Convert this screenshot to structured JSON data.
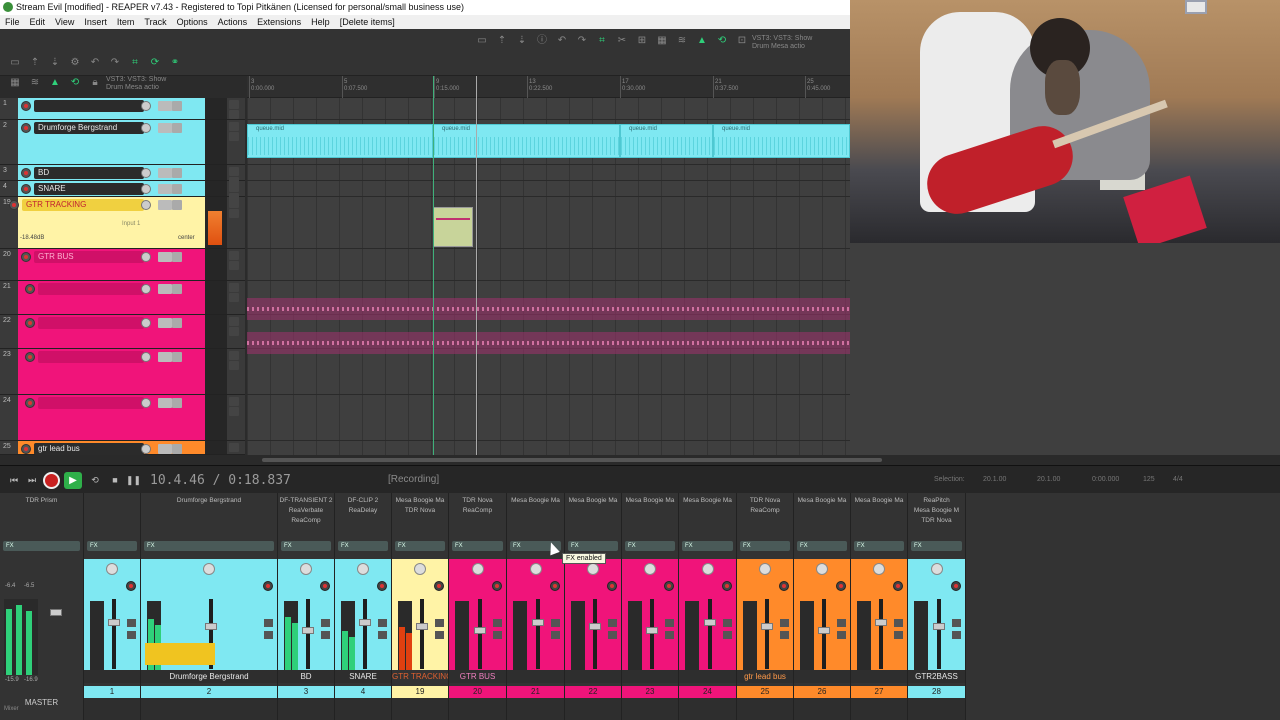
{
  "window": {
    "title": "Stream Evil [modified] - REAPER v7.43 - Registered to Topi Pitkänen (Licensed for personal/small business use)"
  },
  "menu": [
    "File",
    "Edit",
    "View",
    "Insert",
    "Item",
    "Track",
    "Options",
    "Actions",
    "Extensions",
    "Help",
    "[Delete items]"
  ],
  "toolbar": {
    "vst_top": "VST3: VST3: Show",
    "vst_bottom": "Drum Mesa actio"
  },
  "tcp": {
    "tracks": [
      {
        "name": "",
        "num": "1",
        "color": "#7fe8f2"
      },
      {
        "name": "Drumforge Bergstrand",
        "num": "2",
        "color": "#7fe8f2"
      },
      {
        "name": "BD",
        "num": "3",
        "color": "#7fe8f2"
      },
      {
        "name": "SNARE",
        "num": "4",
        "color": "#7fe8f2"
      },
      {
        "name": "GTR TRACKING",
        "num": "19",
        "color": "#fff3a6",
        "vol": "-18.48dB",
        "input": "Input 1",
        "pan": "center"
      },
      {
        "name": "GTR BUS",
        "num": "20",
        "color": "#f0147a"
      },
      {
        "name": "",
        "num": "21",
        "color": "#f0147a"
      },
      {
        "name": "",
        "num": "22",
        "color": "#f0147a"
      },
      {
        "name": "",
        "num": "23",
        "color": "#f0147a"
      },
      {
        "name": "",
        "num": "24",
        "color": "#f0147a"
      },
      {
        "name": "gtr lead bus",
        "num": "25",
        "color": "#ff8a2a"
      }
    ]
  },
  "ruler": {
    "marks": [
      {
        "bar": "3",
        "time": "0:00.000"
      },
      {
        "bar": "5",
        "time": "0:07.500"
      },
      {
        "bar": "9",
        "time": "0:15.000"
      },
      {
        "bar": "13",
        "time": "0:22.500"
      },
      {
        "bar": "17",
        "time": "0:30.000"
      },
      {
        "bar": "21",
        "time": "0:37.500"
      },
      {
        "bar": "25",
        "time": "0:45.000"
      }
    ]
  },
  "arrange": {
    "midi_items": [
      "queue.mid",
      "queue.mid",
      "queue.mid",
      "queue.mid"
    ]
  },
  "transport": {
    "position": "10.4.46 / 0:18.837",
    "status": "[Recording]",
    "selection_label": "Selection:",
    "sel_start": "20.1.00",
    "sel_end": "20.1.00",
    "sel_len": "0:00.000",
    "bpm": "125",
    "timesig": "4/4"
  },
  "mixer": {
    "master": {
      "name": "MASTER",
      "fx": "TDR Prism",
      "vol": "-15.9",
      "vol2": "-16.9",
      "peak": "-6.4",
      "peak2": "-6.5"
    },
    "strips": [
      {
        "name": "",
        "num": "1",
        "color": "#7fe8f2",
        "fx": ""
      },
      {
        "name": "Drumforge Bergstrand",
        "num": "2",
        "color": "#7fe8f2",
        "fx": "Drumforge Bergstrand"
      },
      {
        "name": "BD",
        "num": "3",
        "color": "#7fe8f2",
        "fx": "DF-TRANSIENT 2\nReaVerbate\nReaComp"
      },
      {
        "name": "SNARE",
        "num": "4",
        "color": "#7fe8f2",
        "fx": "DF-CLIP 2\nReaDelay"
      },
      {
        "name": "GTR TRACKING",
        "num": "19",
        "color": "#fff3a6",
        "fx": "Mesa Boogie Ma\nTDR Nova"
      },
      {
        "name": "GTR BUS",
        "num": "20",
        "color": "#f0147a",
        "fx": "TDR Nova\nReaComp"
      },
      {
        "name": "",
        "num": "21",
        "color": "#f0147a",
        "fx": "Mesa Boogie Ma"
      },
      {
        "name": "",
        "num": "22",
        "color": "#f0147a",
        "fx": "Mesa Boogie Ma"
      },
      {
        "name": "",
        "num": "23",
        "color": "#f0147a",
        "fx": "Mesa Boogie Ma"
      },
      {
        "name": "",
        "num": "24",
        "color": "#f0147a",
        "fx": "Mesa Boogie Ma"
      },
      {
        "name": "gtr lead bus",
        "num": "25",
        "color": "#ff8a2a",
        "fx": "TDR Nova\nReaComp"
      },
      {
        "name": "",
        "num": "26",
        "color": "#ff8a2a",
        "fx": "Mesa Boogie Ma"
      },
      {
        "name": "",
        "num": "27",
        "color": "#ff8a2a",
        "fx": "Mesa Boogie Ma"
      },
      {
        "name": "GTR2BASS",
        "num": "28",
        "color": "#7fe8f2",
        "fx": "ReaPitch\nMesa Boogie M\nTDR Nova"
      }
    ],
    "tooltip": "FX enabled",
    "fx_label": "FX",
    "mixer_tab": "Mixer"
  }
}
